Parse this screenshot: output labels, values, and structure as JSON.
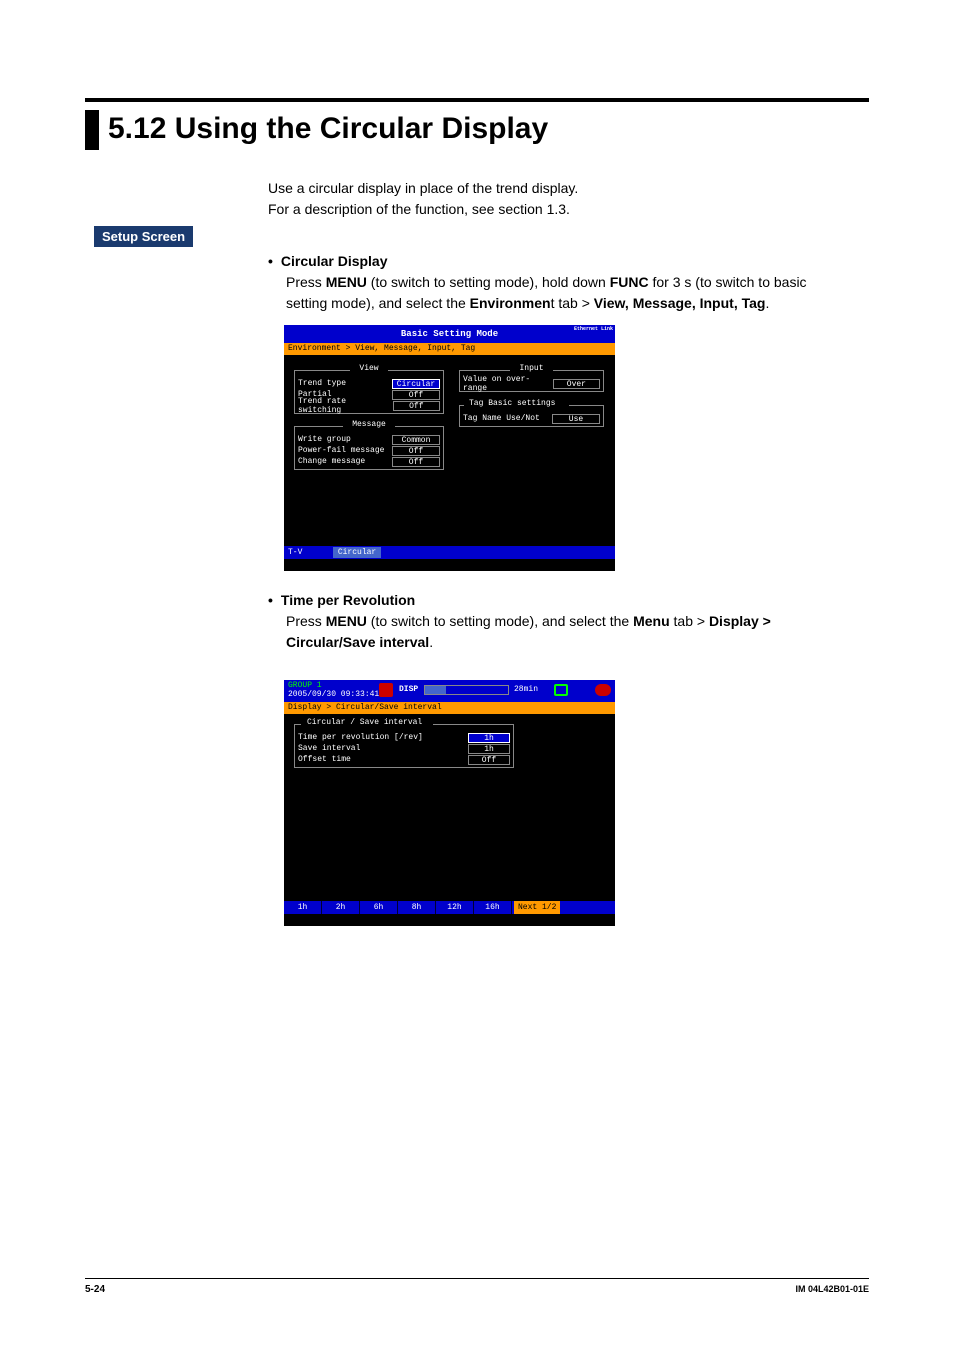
{
  "section": {
    "number_title": "5.12  Using the Circular Display"
  },
  "intro": {
    "line1": "Use a circular display in place of the trend display.",
    "line2": "For a description of the function, see section 1.3."
  },
  "setup_label": "Setup Screen",
  "bullet1": {
    "head": "Circular Display",
    "body_pre": "Press ",
    "menu": "MENU",
    "body_mid1": " (to switch to setting mode), hold down ",
    "func": "FUNC",
    "body_mid2": " for 3 s (to switch to basic setting mode), and select the ",
    "env": "Environmen",
    "body_mid3": "t tab > ",
    "tail": "View, Message, Input, Tag",
    "period": "."
  },
  "shot1": {
    "title": "Basic Setting Mode",
    "eth": "Ethernet\nLink",
    "breadcrumb": "Environment > View, Message, Input, Tag",
    "groups": {
      "view": {
        "label": "View",
        "rows": [
          {
            "lab": "Trend type",
            "val": "Circular",
            "sel": true
          },
          {
            "lab": "Partial",
            "val": "Off"
          },
          {
            "lab": "Trend rate switching",
            "val": "Off"
          }
        ]
      },
      "message": {
        "label": "Message",
        "rows": [
          {
            "lab": "Write group",
            "val": "Common"
          },
          {
            "lab": "Power-fail message",
            "val": "Off"
          },
          {
            "lab": "Change message",
            "val": "Off"
          }
        ]
      },
      "input": {
        "label": "Input",
        "rows": [
          {
            "lab": "Value on over-range",
            "val": "Over"
          }
        ]
      },
      "tag": {
        "label": "Tag Basic settings",
        "rows": [
          {
            "lab": "Tag Name Use/Not",
            "val": "Use"
          }
        ]
      }
    },
    "bottom": {
      "tv": "T-V",
      "val": "Circular"
    }
  },
  "bullet2": {
    "head": "Time per Revolution",
    "body_pre": "Press ",
    "menu": "MENU",
    "body_mid1": " (to switch to setting mode), and select the ",
    "menutab": "Menu",
    "body_mid2": " tab > ",
    "tail": "Display > Circular/Save interval",
    "period": "."
  },
  "shot2": {
    "group": "GROUP 1",
    "date": "2005/09/30 09:33:41",
    "disp": "DISP",
    "min": "28min",
    "breadcrumb": "Display > Circular/Save interval",
    "fgroup": {
      "label": "Circular / Save interval",
      "rows": [
        {
          "lab": "Time per revolution [/rev]",
          "val": "1h",
          "sel": true
        },
        {
          "lab": "Save interval",
          "val": "1h"
        },
        {
          "lab": "Offset time",
          "val": "Off"
        }
      ]
    },
    "tabs": [
      "1h",
      "2h",
      "6h",
      "8h",
      "12h",
      "16h"
    ],
    "next": "Next 1/2"
  },
  "footer": {
    "page": "5-24",
    "doc": "IM 04L42B01-01E"
  }
}
